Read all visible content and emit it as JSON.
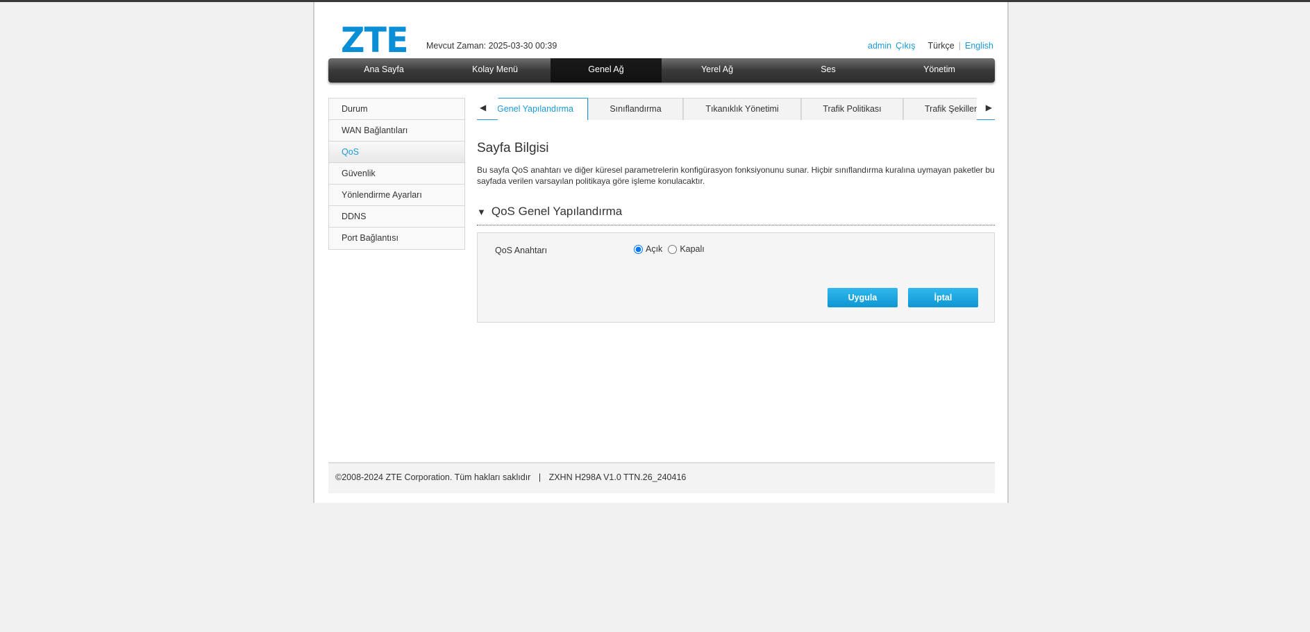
{
  "header": {
    "logo": "ZTE",
    "time_label": "Mevcut Zaman: 2025-03-30 00:39",
    "user": "admin",
    "logout": "Çıkış",
    "lang_current": "Türkçe",
    "lang_sep": "|",
    "lang_other": "English"
  },
  "nav": [
    "Ana Sayfa",
    "Kolay Menü",
    "Genel Ağ",
    "Yerel Ağ",
    "Ses",
    "Yönetim"
  ],
  "sidebar": [
    "Durum",
    "WAN Bağlantıları",
    "QoS",
    "Güvenlik",
    "Yönlendirme Ayarları",
    "DDNS",
    "Port Bağlantısı"
  ],
  "tabs": [
    "Genel Yapılandırma",
    "Sınıflandırma",
    "Tıkanıklık Yönetimi",
    "Trafik Politikası",
    "Trafik Şekillendirme"
  ],
  "page_info": {
    "title": "Sayfa Bilgisi",
    "description": "Bu sayfa QoS anahtarı ve diğer küresel parametrelerin konfigürasyon fonksiyonunu sunar. Hiçbir sınıflandırma kuralına uymayan paketler bu sayfada verilen varsayılan politikaya göre işleme konulacaktır."
  },
  "section": {
    "title": "QoS Genel Yapılandırma",
    "field_label": "QoS Anahtarı",
    "options": [
      "Açık",
      "Kapalı"
    ],
    "selected": "Açık",
    "apply": "Uygula",
    "cancel": "İptal"
  },
  "footer": {
    "copyright": "©2008-2024 ZTE Corporation. Tüm hakları saklıdır",
    "sep": "|",
    "version": "ZXHN H298A V1.0 TTN.26_240416"
  },
  "colors": {
    "accent": "#1a9ad6",
    "button": "#1ba6e0"
  }
}
